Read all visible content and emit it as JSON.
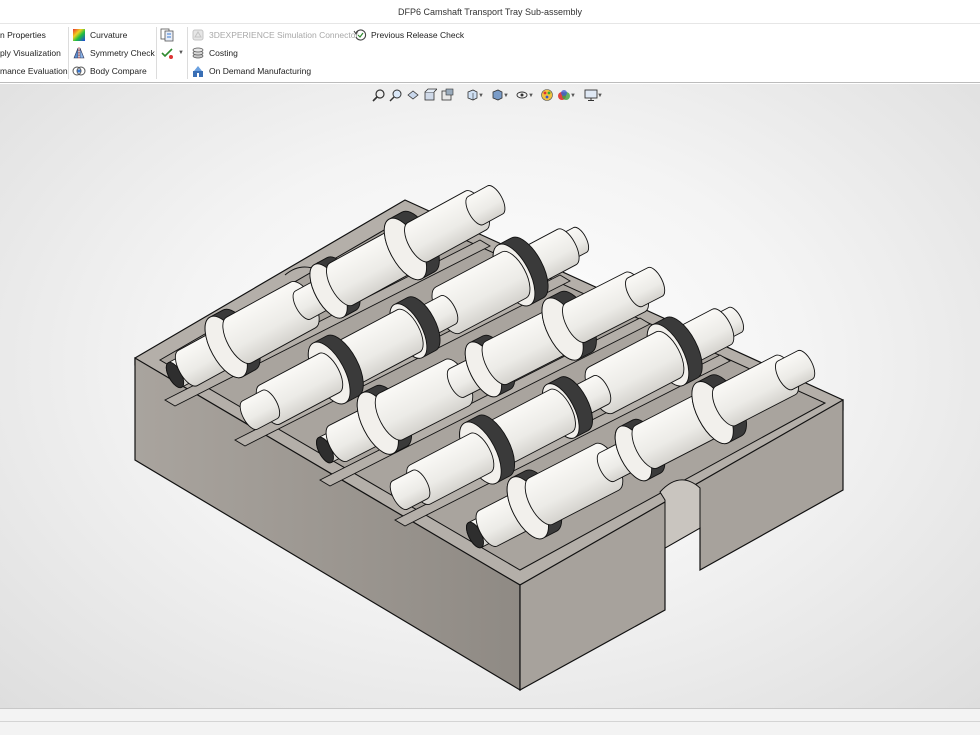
{
  "window": {
    "title": "DFP6 Camshaft Transport Tray Sub-assembly"
  },
  "ribbon": {
    "group1": [
      {
        "label": "n Properties",
        "icon": "properties-icon"
      },
      {
        "label": "ply Visualization",
        "icon": "visualization-icon"
      },
      {
        "label": "mance Evaluation",
        "icon": "evaluation-icon"
      }
    ],
    "group2": [
      {
        "label": "Curvature",
        "icon": "curvature-icon"
      },
      {
        "label": "Symmetry Check",
        "icon": "symmetry-check-icon"
      },
      {
        "label": "Body Compare",
        "icon": "body-compare-icon"
      }
    ],
    "group3": [
      {
        "label": "",
        "icon": "compare-documents-icon"
      },
      {
        "label": "",
        "icon": "check-dropdown-icon"
      }
    ],
    "group4": [
      {
        "label": "3DEXPERIENCE Simulation Connector",
        "icon": "simulation-connector-icon",
        "disabled": true
      },
      {
        "label": "Costing",
        "icon": "costing-icon"
      },
      {
        "label": "On Demand Manufacturing",
        "icon": "on-demand-manufacturing-icon"
      }
    ],
    "group5": [
      {
        "label": "Previous Release Check",
        "icon": "previous-release-check-icon"
      }
    ]
  },
  "view_toolbar": [
    "zoom-to-fit-icon",
    "zoom-to-area-icon",
    "previous-view-icon",
    "section-view-icon",
    "dynamic-annotation-icon",
    "view-orientation-icon",
    "display-style-icon",
    "hide-show-items-icon",
    "edit-appearance-icon",
    "apply-scene-icon",
    "view-settings-icon"
  ],
  "colors": {
    "tray": "#a39e98",
    "tray_top": "#b7b2ac",
    "shaft": "#f0eeea",
    "cam": "#2e2e2e"
  }
}
